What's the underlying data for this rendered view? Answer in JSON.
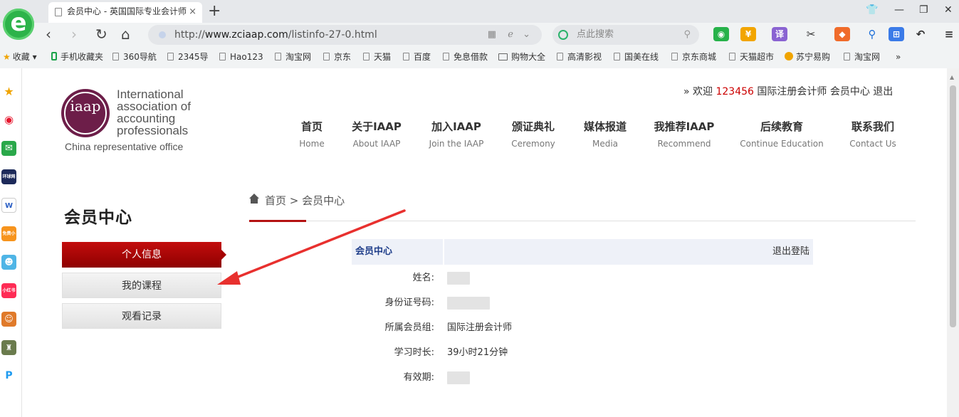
{
  "browser": {
    "tab_title": "会员中心 - 英国国际专业会计师",
    "tab_close": "×",
    "new_tab": "+",
    "url_scheme": "http://",
    "url_host": "www.zciaap.com",
    "url_path": "/listinfo-27-0.html",
    "search_placeholder": "点此搜索",
    "tool_translate": "译",
    "bookmarks": [
      "收藏",
      "手机收藏夹",
      "360导航",
      "2345导",
      "Hao123",
      "淘宝网",
      "京东",
      "天猫",
      "百度",
      "免息借款",
      "购物大全",
      "高清影视",
      "国美在线",
      "京东商城",
      "天猫超市",
      "苏宁易购",
      "淘宝网"
    ],
    "bookmarks_more": "»",
    "sidebar_labels": [
      "环球网校",
      "免费小说",
      "小红书"
    ]
  },
  "site": {
    "logo_mark": "iaap",
    "logo_lines": [
      "International",
      "association of",
      "accounting",
      "professionals"
    ],
    "logo_sub": "China representative office",
    "welcome_prefix": "» 欢迎",
    "welcome_user": "123456",
    "welcome_group": "国际注册会计师",
    "welcome_center": "会员中心",
    "welcome_logout": "退出",
    "nav": [
      {
        "cn": "首页",
        "en": "Home"
      },
      {
        "cn": "关于IAAP",
        "en": "About IAAP"
      },
      {
        "cn": "加入IAAP",
        "en": "Join the IAAP"
      },
      {
        "cn": "颁证典礼",
        "en": "Ceremony"
      },
      {
        "cn": "媒体报道",
        "en": "Media"
      },
      {
        "cn": "我推荐IAAP",
        "en": "Recommend"
      },
      {
        "cn": "后续教育",
        "en": "Continue Education"
      },
      {
        "cn": "联系我们",
        "en": "Contact Us"
      }
    ]
  },
  "member": {
    "title": "会员中心",
    "menu": [
      "个人信息",
      "我的课程",
      "观看记录"
    ],
    "breadcrumb_home": "首页",
    "breadcrumb_sep": ">",
    "breadcrumb_current": "会员中心",
    "panel_title": "会员中心",
    "panel_logout": "退出登陆",
    "fields": [
      {
        "label": "姓名:",
        "value": ""
      },
      {
        "label": "身份证号码:",
        "value": ""
      },
      {
        "label": "所属会员组:",
        "value": "国际注册会计师"
      },
      {
        "label": "学习时长:",
        "value": "39小时21分钟"
      },
      {
        "label": "有效期:",
        "value": ""
      }
    ]
  },
  "colors": {
    "accent_red": "#b41212",
    "panel_blue": "#1f3e8a",
    "logo_purple": "#6d1e49",
    "annotation_arrow": "#e8302e"
  }
}
